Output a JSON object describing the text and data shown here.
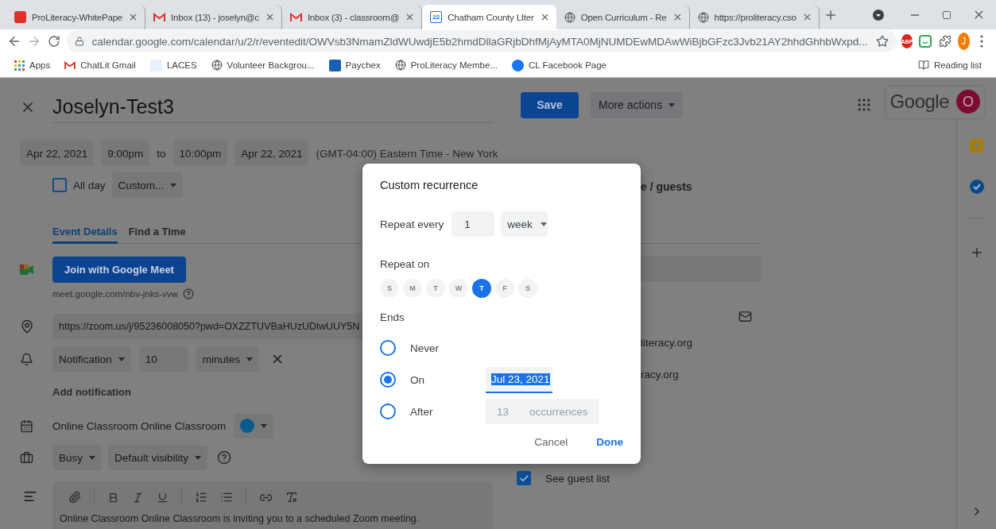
{
  "browser": {
    "tabs": [
      {
        "title": "ProLiteracy-WhitePape",
        "kind": "proliteracy",
        "selected": false
      },
      {
        "title": "Inbox (13) - joselyn@c",
        "kind": "gmail",
        "selected": false
      },
      {
        "title": "Inbox (3) - classroom@",
        "kind": "gmail",
        "selected": false
      },
      {
        "title": "Chatham County LIter",
        "kind": "calendar",
        "selected": true
      },
      {
        "title": "Open Curriculum - Re",
        "kind": "globe",
        "selected": false
      },
      {
        "title": "https://proliteracy.cso",
        "kind": "globe",
        "selected": false
      }
    ],
    "calendar_favicon_day": "22",
    "address": "calendar.google.com/calendar/u/2/r/eventedit/OWVsb3NmamZldWUwdjE5b2hmdDllaGRjbDhfMjAyMTA0MjNUMDEwMDAwWiBjbGFzc3Jvb21AY2hhdGhhbWxpd...",
    "adblock_label": "ABP",
    "profile_initial": "J",
    "bookmarks": [
      {
        "label": "Apps",
        "kind": "apps"
      },
      {
        "label": "ChatLit Gmail",
        "kind": "gmail"
      },
      {
        "label": "LACES",
        "kind": "laces"
      },
      {
        "label": "Volunteer Backgrou...",
        "kind": "globe"
      },
      {
        "label": "Paychex",
        "kind": "paychex"
      },
      {
        "label": "ProLiteracy Membe...",
        "kind": "globe"
      },
      {
        "label": "CL Facebook Page",
        "kind": "facebook"
      }
    ],
    "reading_list": "Reading list"
  },
  "event": {
    "title": "Joselyn-Test3",
    "start_date": "Apr 22, 2021",
    "start_time": "9:00pm",
    "to": "to",
    "end_time": "10:00pm",
    "end_date": "Apr 22, 2021",
    "timezone": "(GMT-04:00) Eastern Time - New York",
    "all_day": {
      "label": "All day",
      "checked": false
    },
    "recurrence": "Custom...",
    "tabs": [
      {
        "label": "Event Details",
        "selected": true
      },
      {
        "label": "Find a Time",
        "selected": false
      }
    ],
    "meet_button": "Join with Google Meet",
    "meet_link": "meet.google.com/nbv-jnks-vvw",
    "location": "https://zoom.us/j/95236008050?pwd=OXZZTUVBaHUzUDlwUUY5N",
    "notification": {
      "type": "Notification",
      "value": "10",
      "unit": "minutes"
    },
    "add_notification": "Add notification",
    "calendar_name": "Online Classroom Online Classroom",
    "availability": "Busy",
    "visibility": "Default visibility",
    "description": "Online Classroom Online Classroom is inviting you to a scheduled Zoom meeting."
  },
  "header": {
    "save": "Save",
    "more_actions": "More actions",
    "logo": "Google",
    "account_initial": "O"
  },
  "guests": {
    "fragments": [
      {
        "text": "e / guests",
        "kind": "heading"
      },
      {
        "text": "literacy.org",
        "kind": "email"
      },
      {
        "text": "racy.org",
        "kind": "email"
      }
    ],
    "see_guest_list": {
      "label": "See guest list",
      "checked": true
    }
  },
  "dialog": {
    "title": "Custom recurrence",
    "repeat_every_label": "Repeat every",
    "interval": "1",
    "unit": "week",
    "repeat_on_label": "Repeat on",
    "days": [
      {
        "label": "S",
        "selected": false
      },
      {
        "label": "M",
        "selected": false
      },
      {
        "label": "T",
        "selected": false
      },
      {
        "label": "W",
        "selected": false
      },
      {
        "label": "T",
        "selected": true
      },
      {
        "label": "F",
        "selected": false
      },
      {
        "label": "S",
        "selected": false
      }
    ],
    "ends_label": "Ends",
    "end_options": [
      {
        "label": "Never",
        "selected": false,
        "kind": "none"
      },
      {
        "label": "On",
        "selected": true,
        "kind": "date",
        "value": "Jul 23, 2021",
        "highlighted": true
      },
      {
        "label": "After",
        "selected": false,
        "kind": "count",
        "value": "13",
        "suffix": "occurrences"
      }
    ],
    "cancel": "Cancel",
    "done": "Done"
  }
}
